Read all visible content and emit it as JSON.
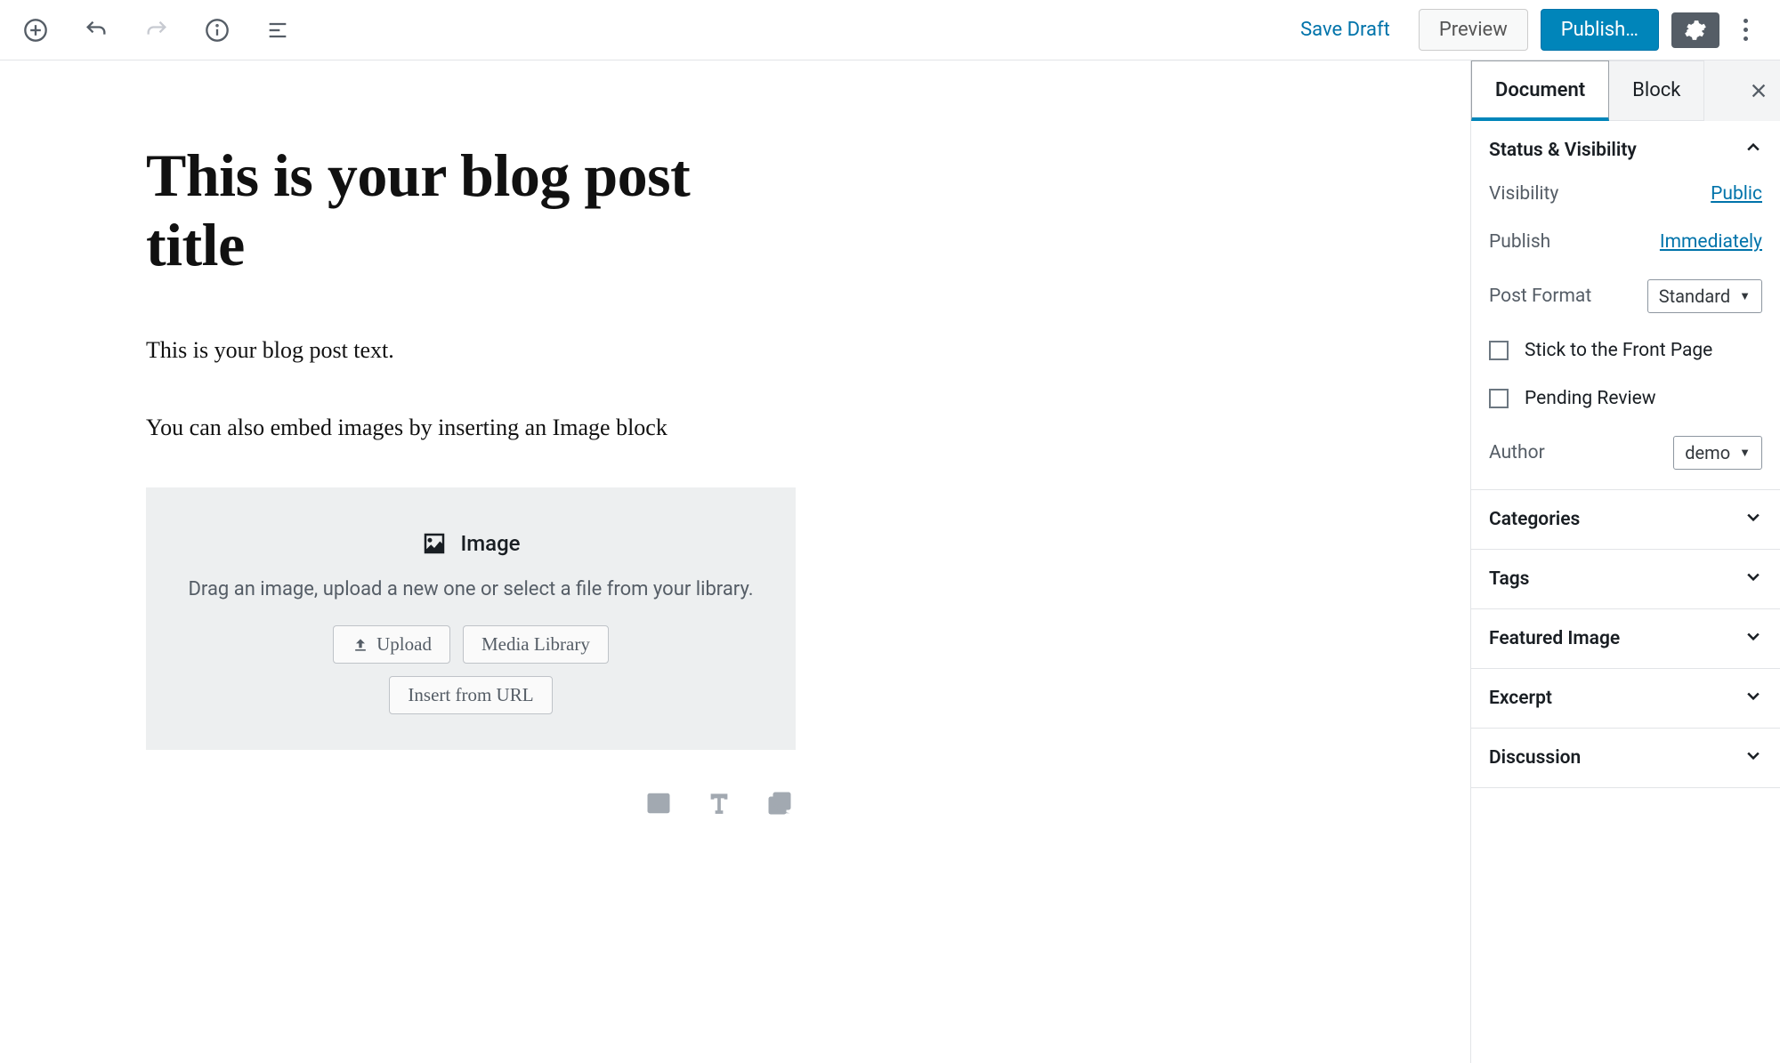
{
  "toolbar": {
    "save_draft": "Save Draft",
    "preview": "Preview",
    "publish": "Publish…"
  },
  "editor": {
    "title": "This is your blog post title",
    "para1": "This is your blog post text.",
    "para2": "You can also embed images by inserting an Image block",
    "image_block": {
      "label": "Image",
      "desc": "Drag an image, upload a new one or select a file from your library.",
      "upload": "Upload",
      "media_library": "Media Library",
      "insert_url": "Insert from URL"
    }
  },
  "sidebar": {
    "tabs": {
      "document": "Document",
      "block": "Block"
    },
    "status": {
      "title": "Status & Visibility",
      "visibility_label": "Visibility",
      "visibility_value": "Public",
      "publish_label": "Publish",
      "publish_value": "Immediately",
      "post_format_label": "Post Format",
      "post_format_value": "Standard",
      "stick": "Stick to the Front Page",
      "pending": "Pending Review",
      "author_label": "Author",
      "author_value": "demo"
    },
    "panels": {
      "categories": "Categories",
      "tags": "Tags",
      "featured_image": "Featured Image",
      "excerpt": "Excerpt",
      "discussion": "Discussion"
    }
  }
}
